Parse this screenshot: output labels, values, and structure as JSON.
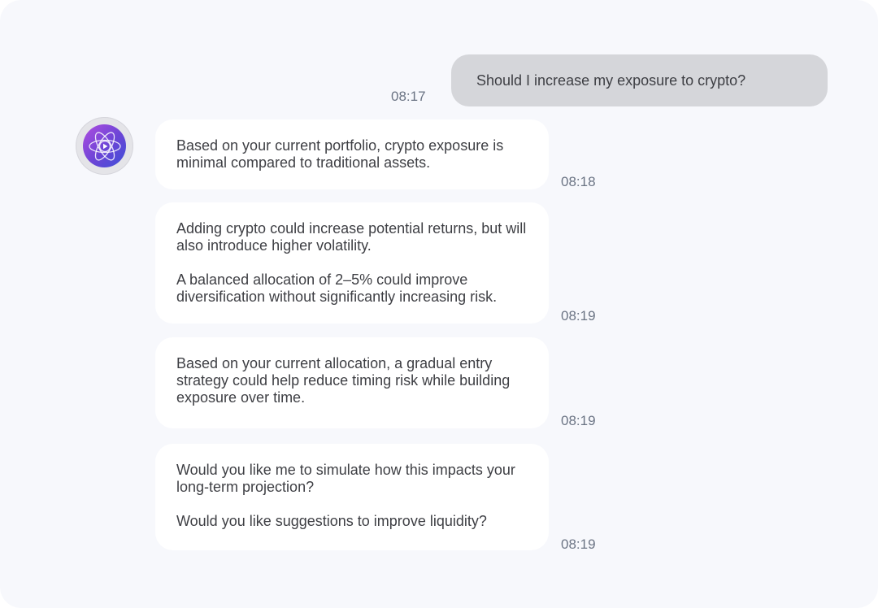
{
  "user_message": {
    "text": "Should I increase my exposure to crypto?",
    "time": "08:17"
  },
  "assistant": {
    "avatar_icon": "atom-play-icon",
    "accent_gradient": [
      "#b04de0",
      "#6a45d6",
      "#3d4fd8"
    ]
  },
  "assistant_messages": [
    {
      "paragraphs": [
        "Based on your current portfolio, crypto exposure is minimal compared to traditional assets."
      ],
      "time": "08:18"
    },
    {
      "paragraphs": [
        "Adding crypto could increase potential returns, but will also introduce higher volatility.",
        "A balanced allocation of 2–5% could improve diversification without significantly increasing risk."
      ],
      "time": "08:19"
    },
    {
      "paragraphs": [
        "Based on your current allocation, a gradual entry strategy could help reduce timing risk while building exposure over time."
      ],
      "time": "08:19"
    },
    {
      "paragraphs": [
        "Would you like me to simulate how this impacts your long-term projection?",
        "Would you like suggestions to improve liquidity?"
      ],
      "time": "08:19"
    }
  ]
}
